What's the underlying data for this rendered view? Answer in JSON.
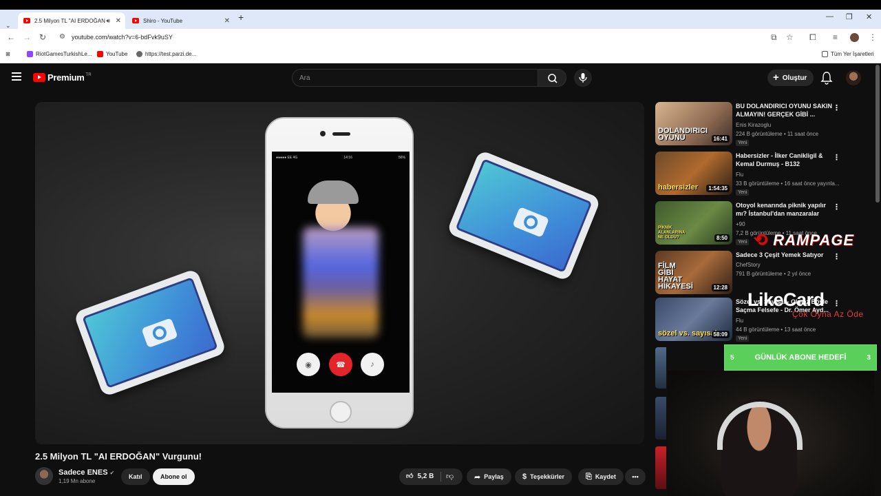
{
  "browser": {
    "tabs": [
      {
        "title": "2.5 Milyon TL \"AI ERDOĞAN",
        "active": true
      },
      {
        "title": "Shiro - YouTube",
        "active": false
      }
    ],
    "url": "youtube.com/watch?v=6-bdFvk9uSY",
    "bookmarks": [
      "RiotGamesTurkishLe...",
      "YouTube",
      "https://test.parzi.de..."
    ],
    "all_bookmarks": "Tüm Yer İşaretleri"
  },
  "youtube": {
    "logo_text": "Premium",
    "region": "TR",
    "search_placeholder": "Ara",
    "create_label": "Oluştur"
  },
  "video": {
    "title": "2.5 Milyon TL \"AI ERDOĞAN\" Vurgunu!",
    "channel": "Sadece ENES",
    "subscribers": "1,19 Mn abone",
    "join_label": "Katıl",
    "subscribe_label": "Abone ol",
    "likes": "5,2 B",
    "share_label": "Paylaş",
    "thanks_label": "Teşekkürler",
    "save_label": "Kaydet",
    "phone_status_left": "●●●●● EE 4G",
    "phone_status_time": "14:16",
    "phone_status_right": "56%"
  },
  "recommendations": [
    {
      "title": "BU DOLANDIRICI OYUNU SAKIN ALMAYIN! GERÇEK GİBİ ...",
      "channel": "Enis Kirazoglu",
      "meta": "224 B görüntüleme • 11 saat önce",
      "badge": "Yeni",
      "duration": "16:41",
      "thumb_text": "DOLANDIRICI OYUNU"
    },
    {
      "title": "Habersizler - İlker Canikligil & Kemal Durmuş - B132",
      "channel": "Flu",
      "meta": "33 B görüntüleme • 16 saat önce yayınla...",
      "badge": "Yeni",
      "duration": "1:54:35",
      "thumb_text": "habersizler"
    },
    {
      "title": "Otoyol kenarında piknik yapılır mı? İstanbul'dan manzaralar",
      "channel": "+90",
      "meta": "7,2 B görüntüleme • 11 saat önce",
      "badge": "Yeni",
      "duration": "8:50",
      "thumb_text": "PİKNİK ALANLARINA NE OLDU?"
    },
    {
      "title": "Sadece 3 Çeşit Yemek Satıyor",
      "channel": "ChefStory",
      "meta": "791 B görüntüleme • 2 yıl önce",
      "badge": "",
      "duration": "12:28",
      "thumb_text": "FİLM GİBİ HAYAT HİKAYESİ"
    },
    {
      "title": "Sözel vs. Sayısal - Olmaz Böyle Saçma Felsefe - Dr. Ömer Ayd...",
      "channel": "Flu",
      "meta": "44 B görüntüleme • 13 saat önce",
      "badge": "Yeni",
      "duration": "58:09",
      "thumb_text": "sözel vs. sayısal"
    }
  ],
  "overlays": {
    "rampage": "RAMPAGE",
    "likecard": "LikeCard",
    "likecard_slogan": "Çok Oyna  Az Öde",
    "goal_left": "5",
    "goal_text": "GÜNLÜK ABONE HEDEFİ",
    "goal_right": "3"
  },
  "colors": {
    "yt_red": "#ff0000",
    "background": "#0f0f0f",
    "goal_green": "#5ad05a"
  }
}
